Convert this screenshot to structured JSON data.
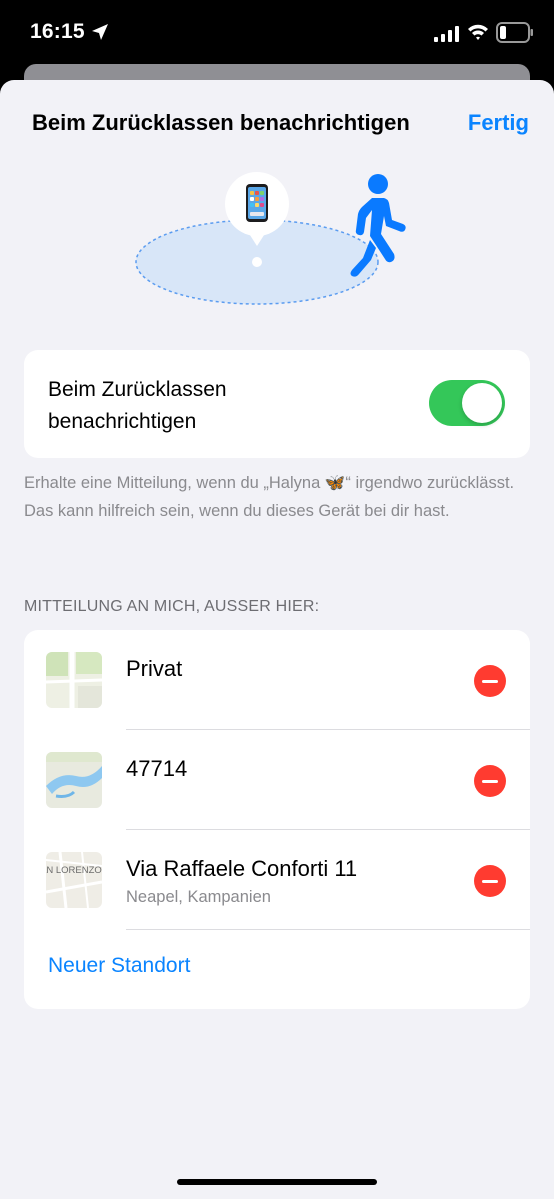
{
  "status_bar": {
    "time": "16:15"
  },
  "sheet": {
    "title": "Beim Zurücklassen benachrichtigen",
    "done_label": "Fertig"
  },
  "toggle": {
    "label": "Beim Zurücklassen benachrichtigen",
    "state": "on"
  },
  "description": "Erhalte eine Mitteilung, wenn du „Halyna 🦋“ irgendwo zurücklässt. Das kann hilfreich sein, wenn du dieses Gerät bei dir hast.",
  "section_header": "MITTEILUNG AN MICH, AUSSER HIER:",
  "locations": [
    {
      "name": "Privat",
      "subtitle": ""
    },
    {
      "name": "47714",
      "subtitle": ""
    },
    {
      "name": "Via Raffaele Conforti 11",
      "subtitle": "Neapel, Kampanien",
      "map_label": "AN LORENZO"
    }
  ],
  "new_location_label": "Neuer Standort",
  "colors": {
    "accent": "#0a84ff",
    "toggle_on": "#34c759",
    "remove": "#ff3b30"
  }
}
